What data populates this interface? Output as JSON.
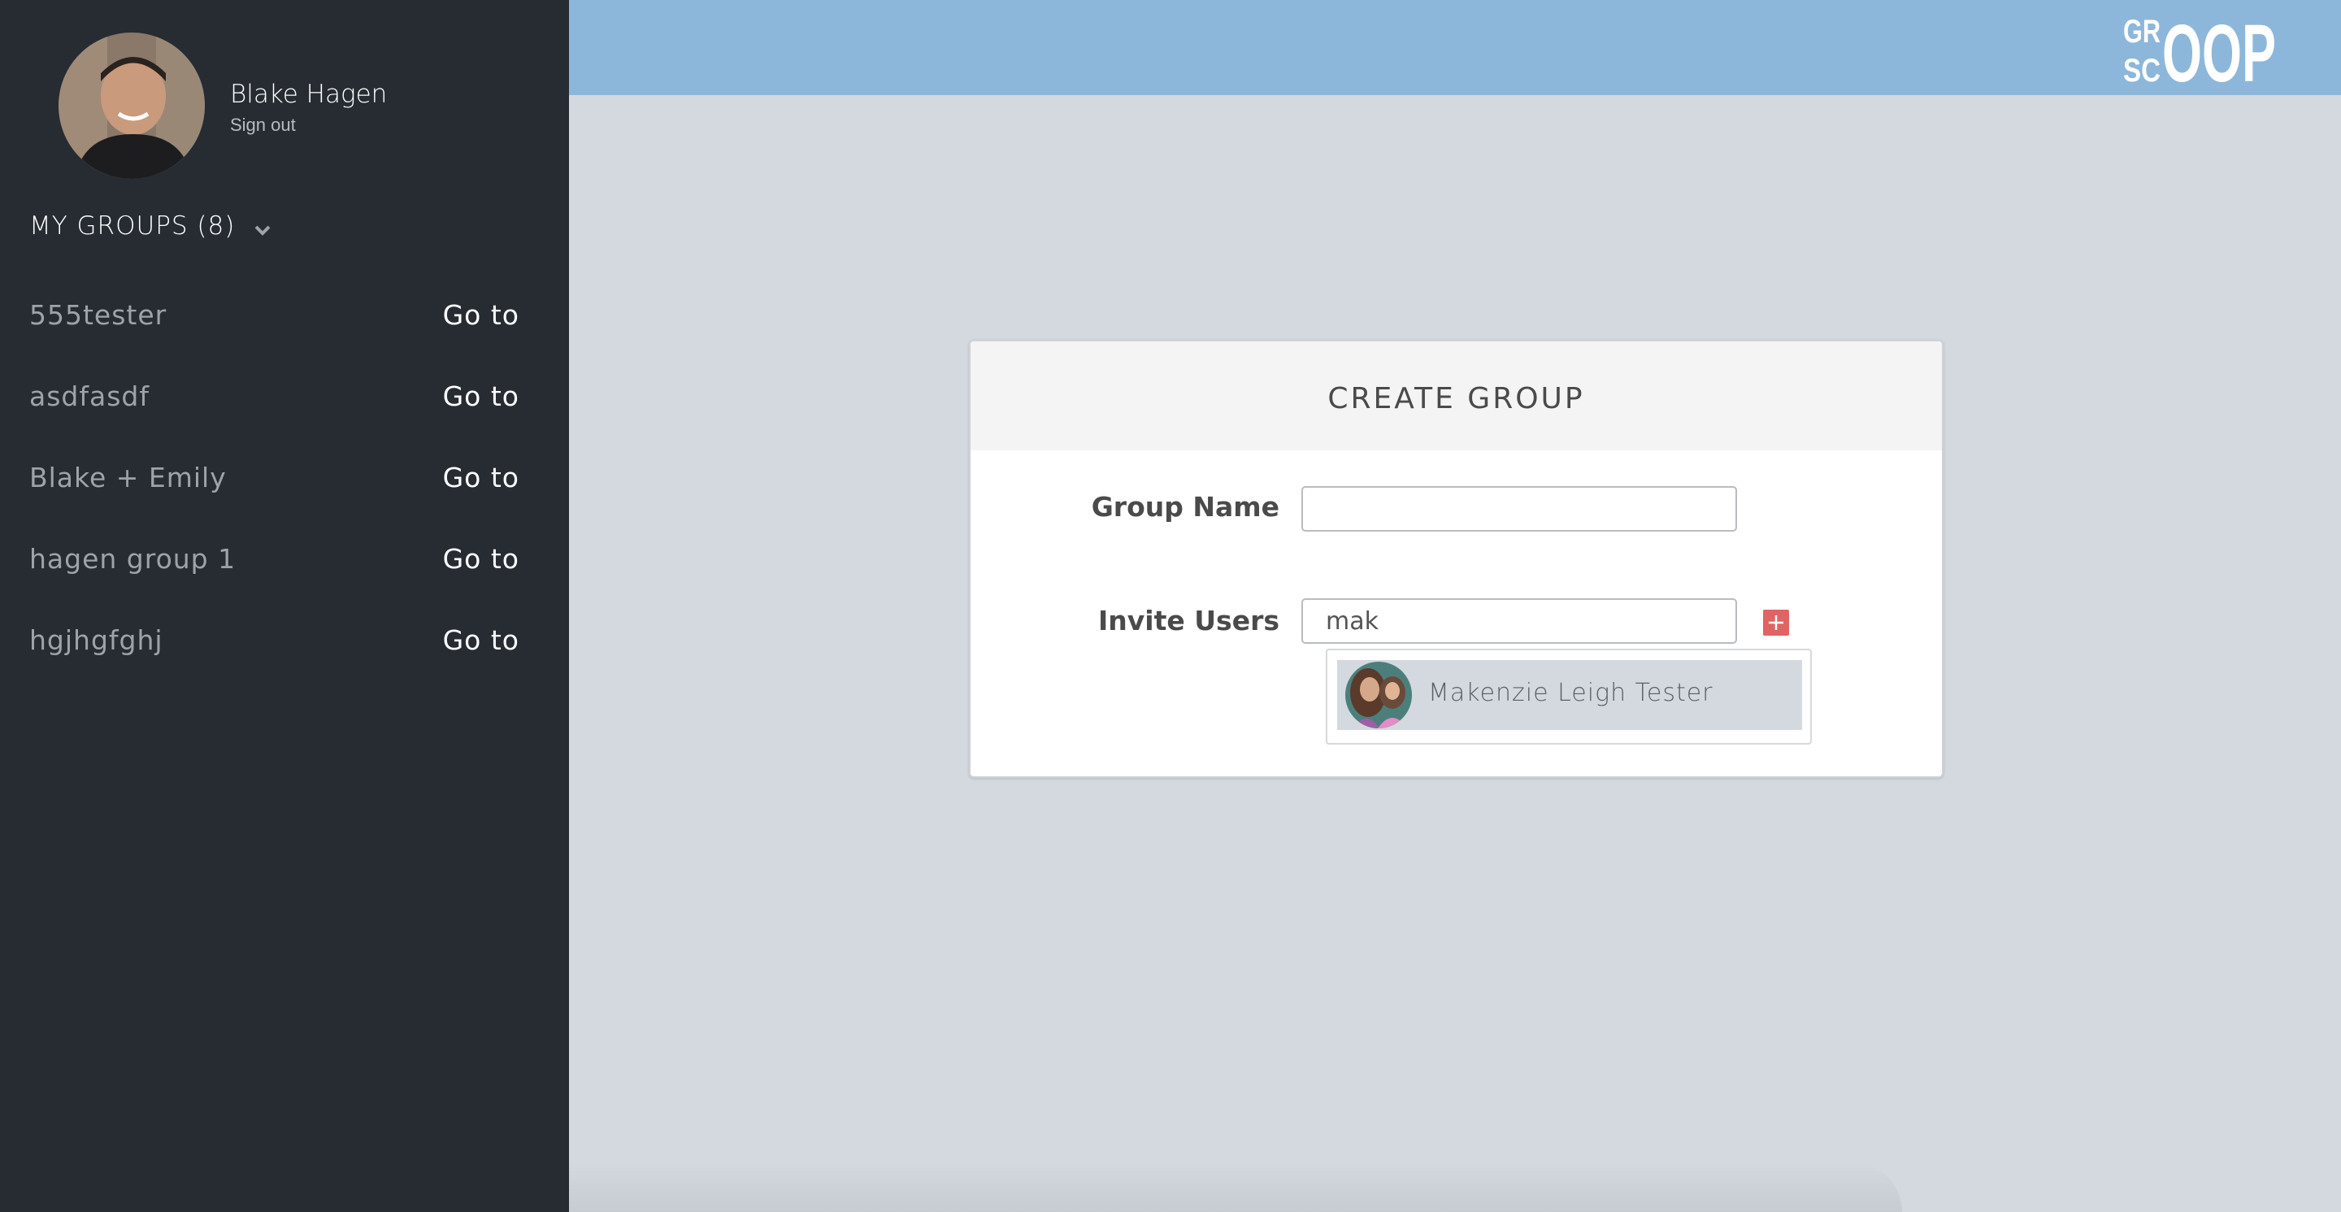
{
  "user": {
    "name": "Blake Hagen",
    "signout_label": "Sign out"
  },
  "sidebar": {
    "groups_header": "MY GROUPS (8)",
    "groups": [
      {
        "name": "555tester",
        "action": "Go to"
      },
      {
        "name": "asdfasdf",
        "action": "Go to"
      },
      {
        "name": "Blake + Emily",
        "action": "Go to"
      },
      {
        "name": "hagen group 1",
        "action": "Go to"
      },
      {
        "name": "hgjhgfghj",
        "action": "Go to"
      }
    ]
  },
  "brand": {
    "logo_small_top": "GR",
    "logo_small_bottom": "SC",
    "logo_big": "OOP",
    "topbar_color": "#8db7da"
  },
  "create_group": {
    "title": "CREATE GROUP",
    "group_name_label": "Group Name",
    "group_name_value": "",
    "invite_users_label": "Invite Users",
    "invite_users_value": "mak",
    "add_icon": "plus-icon",
    "add_color": "#e06464",
    "suggestions": [
      {
        "name": "Makenzie Leigh Tester"
      }
    ]
  }
}
